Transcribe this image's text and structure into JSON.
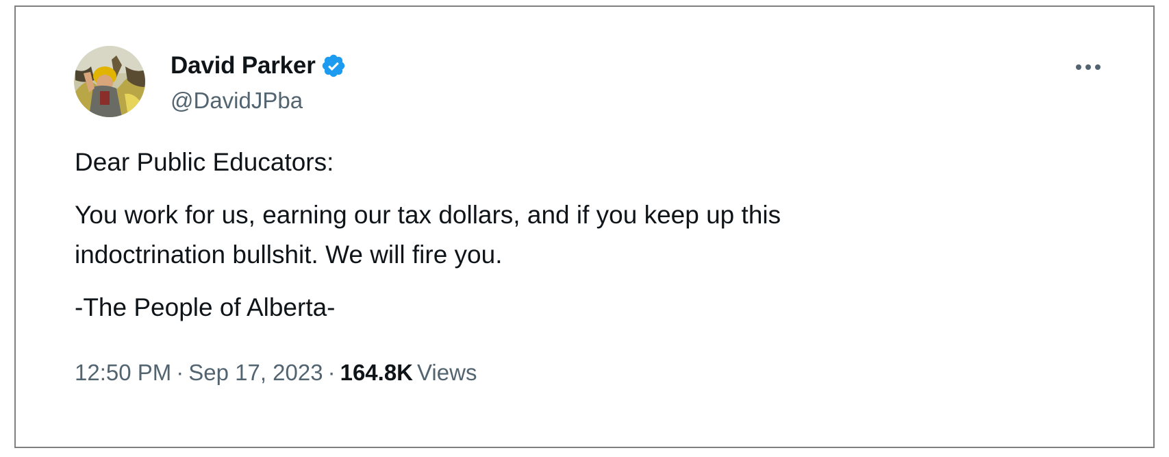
{
  "tweet": {
    "author": {
      "display_name": "David Parker",
      "handle": "@DavidJPba",
      "verified": true
    },
    "body": {
      "greeting": "Dear Public Educators:",
      "line1": "You work for us, earning our tax dollars, and if you keep up this",
      "line2": "indoctrination bullshit. We will fire you.",
      "signature": "-The People of Alberta-"
    },
    "meta": {
      "time": "12:50 PM",
      "separator": "·",
      "date": "Sep 17, 2023",
      "views_count": "164.8K",
      "views_label": "Views"
    }
  },
  "colors": {
    "text_primary": "#0f1419",
    "text_secondary": "#536471",
    "verified_badge": "#1d9bf0",
    "border": "#7f7f7f"
  },
  "icons": {
    "verified": "verified-badge-icon",
    "more": "more-horizontal-icon"
  }
}
